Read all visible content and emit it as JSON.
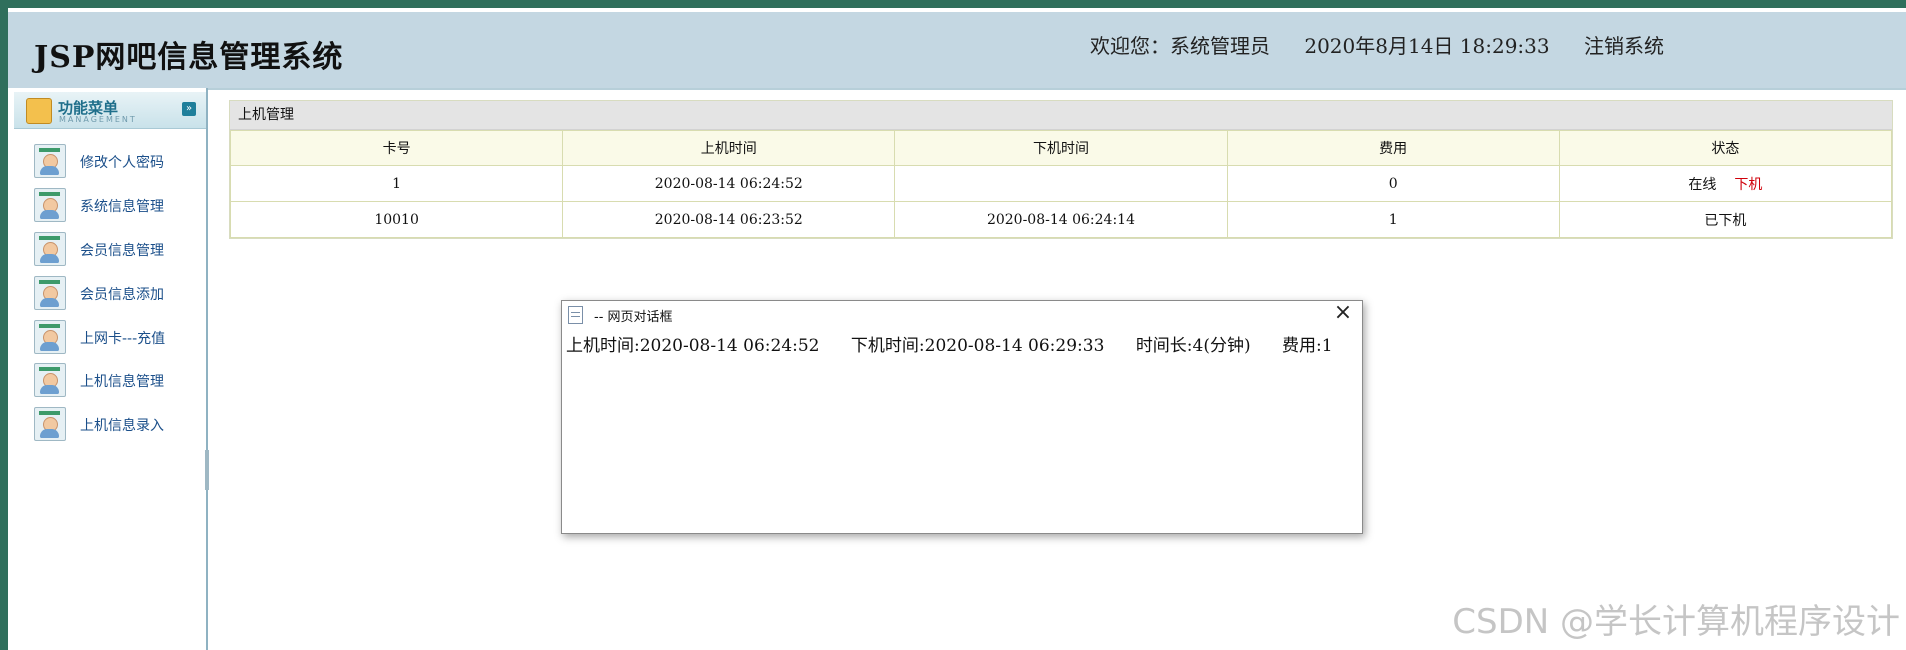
{
  "header": {
    "title": "JSP网吧信息管理系统",
    "welcome": "欢迎您：系统管理员",
    "datetime": "2020年8月14日  18:29:33",
    "logout": "注销系统"
  },
  "sidebar": {
    "title": "功能菜单",
    "subtitle": "MANAGEMENT",
    "items": [
      {
        "label": "修改个人密码"
      },
      {
        "label": "系统信息管理"
      },
      {
        "label": "会员信息管理"
      },
      {
        "label": "会员信息添加"
      },
      {
        "label": "上网卡---充值"
      },
      {
        "label": "上机信息管理"
      },
      {
        "label": "上机信息录入"
      }
    ]
  },
  "panel": {
    "title": "上机管理",
    "columns": [
      "卡号",
      "上机时间",
      "下机时间",
      "费用",
      "状态"
    ],
    "rows": [
      {
        "card": "1",
        "start": "2020-08-14 06:24:52",
        "end": "",
        "fee": "0",
        "status": "在线",
        "action": "下机"
      },
      {
        "card": "10010",
        "start": "2020-08-14 06:23:52",
        "end": "2020-08-14 06:24:14",
        "fee": "1",
        "status": "已下机",
        "action": ""
      }
    ]
  },
  "dialog": {
    "title": "-- 网页对话框",
    "start": "上机时间:2020-08-14 06:24:52",
    "end": "下机时间:2020-08-14 06:29:33",
    "duration": "时间长:4(分钟)",
    "fee": "费用:1"
  },
  "watermark": "CSDN @学长计算机程序设计",
  "colors": {
    "header_bg": "#c4d7e2",
    "frame": "#2f6f5c",
    "action": "#d0000a",
    "menu_text": "#1b4f8a"
  }
}
